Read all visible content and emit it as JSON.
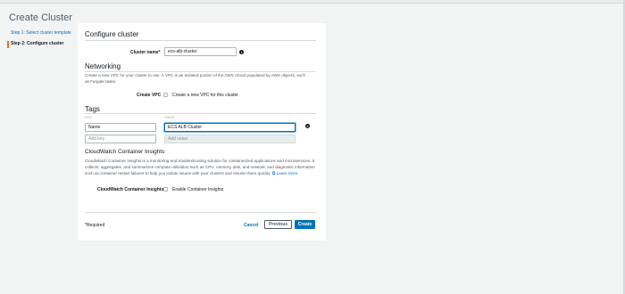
{
  "page": {
    "title": "Create Cluster"
  },
  "steps": [
    {
      "label": "Step 1: Select cluster template"
    },
    {
      "label": "Step 2: Configure cluster"
    }
  ],
  "configure": {
    "title": "Configure cluster",
    "cluster_name_label": "Cluster name*",
    "cluster_name_value": "ecs-alb-cluster",
    "info_icon": "info-icon"
  },
  "networking": {
    "title": "Networking",
    "desc1": "Create a new VPC for your cluster to use. A VPC is an isolated portion of the AWS Cloud populated by AWS objects, such",
    "desc2": "as Fargate tasks.",
    "create_vpc_label": "Create VPC",
    "create_vpc_checkbox_label": "Create a new VPC for this cluster"
  },
  "tags": {
    "title": "Tags",
    "key_header": "Key",
    "value_header": "Value",
    "rows": [
      {
        "key": "Name",
        "value": "ECS ALB Cluster"
      }
    ],
    "add_key_placeholder": "Add key",
    "add_value_placeholder": "Add value"
  },
  "insights": {
    "title": "CloudWatch Container Insights",
    "desc1": "CloudWatch Container Insights is a monitoring and troubleshooting solution for containerized applications and microservices. It",
    "desc2": "collects, aggregates, and summarizes compute utilization such as CPU, memory, disk, and network; and diagnostic information",
    "desc3": "such as container restart failures to help you isolate issues with your clusters and resolve them quickly.",
    "learn_more": "Learn more",
    "label": "CloudWatch Container Insights",
    "checkbox_label": "Enable Container Insights"
  },
  "footer": {
    "required": "*Required",
    "cancel": "Cancel",
    "previous": "Previous",
    "create": "Create"
  },
  "colors": {
    "accent": "#0073bb",
    "step_indicator": "#ec7211",
    "background": "#f2f3f3"
  }
}
